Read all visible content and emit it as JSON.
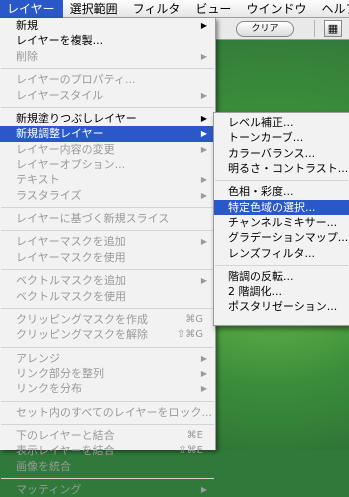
{
  "menubar": {
    "items": [
      {
        "label": "レイヤー",
        "active": true
      },
      {
        "label": "選択範囲",
        "active": false
      },
      {
        "label": "フィルタ",
        "active": false
      },
      {
        "label": "ビュー",
        "active": false
      },
      {
        "label": "ウインドウ",
        "active": false
      },
      {
        "label": "ヘルプ",
        "active": false
      }
    ]
  },
  "toolbar": {
    "clear_label": "クリア",
    "icon": "palette-icon"
  },
  "layer_menu": {
    "groups": [
      [
        {
          "label": "新規",
          "enabled": true,
          "submenu": true
        },
        {
          "label": "レイヤーを複製...",
          "enabled": true
        },
        {
          "label": "削除",
          "enabled": false,
          "submenu": true
        }
      ],
      [
        {
          "label": "レイヤーのプロパティ...",
          "enabled": false
        },
        {
          "label": "レイヤースタイル",
          "enabled": false,
          "submenu": true
        }
      ],
      [
        {
          "label": "新規塗りつぶしレイヤー",
          "enabled": true,
          "submenu": true
        },
        {
          "label": "新規調整レイヤー",
          "enabled": true,
          "submenu": true,
          "selected": true
        },
        {
          "label": "レイヤー内容の変更",
          "enabled": false,
          "submenu": true
        },
        {
          "label": "レイヤーオプション...",
          "enabled": false
        },
        {
          "label": "テキスト",
          "enabled": false,
          "submenu": true
        },
        {
          "label": "ラスタライズ",
          "enabled": false,
          "submenu": true
        }
      ],
      [
        {
          "label": "レイヤーに基づく新規スライス",
          "enabled": false
        }
      ],
      [
        {
          "label": "レイヤーマスクを追加",
          "enabled": false,
          "submenu": true
        },
        {
          "label": "レイヤーマスクを使用",
          "enabled": false
        }
      ],
      [
        {
          "label": "ベクトルマスクを追加",
          "enabled": false,
          "submenu": true
        },
        {
          "label": "ベクトルマスクを使用",
          "enabled": false
        }
      ],
      [
        {
          "label": "クリッピングマスクを作成",
          "enabled": false,
          "shortcut": "⌘G"
        },
        {
          "label": "クリッピングマスクを解除",
          "enabled": false,
          "shortcut": "⇧⌘G"
        }
      ],
      [
        {
          "label": "アレンジ",
          "enabled": false,
          "submenu": true
        },
        {
          "label": "リンク部分を整列",
          "enabled": false,
          "submenu": true
        },
        {
          "label": "リンクを分布",
          "enabled": false,
          "submenu": true
        }
      ],
      [
        {
          "label": "セット内のすべてのレイヤーをロック...",
          "enabled": false
        }
      ],
      [
        {
          "label": "下のレイヤーと結合",
          "enabled": false,
          "shortcut": "⌘E"
        },
        {
          "label": "表示レイヤーを結合",
          "enabled": false,
          "shortcut": "⇧⌘E"
        },
        {
          "label": "画像を統合",
          "enabled": false
        }
      ],
      [
        {
          "label": "マッティング",
          "enabled": false,
          "submenu": true
        }
      ]
    ]
  },
  "adjustment_submenu": {
    "groups": [
      [
        {
          "label": "レベル補正..."
        },
        {
          "label": "トーンカーブ..."
        },
        {
          "label": "カラーバランス..."
        },
        {
          "label": "明るさ・コントラスト..."
        }
      ],
      [
        {
          "label": "色相・彩度..."
        },
        {
          "label": "特定色域の選択...",
          "selected": true
        },
        {
          "label": "チャンネルミキサー..."
        },
        {
          "label": "グラデーションマップ..."
        },
        {
          "label": "レンズフィルタ..."
        }
      ],
      [
        {
          "label": "階調の反転..."
        },
        {
          "label": "2 階調化..."
        },
        {
          "label": "ポスタリゼーション..."
        }
      ]
    ]
  }
}
